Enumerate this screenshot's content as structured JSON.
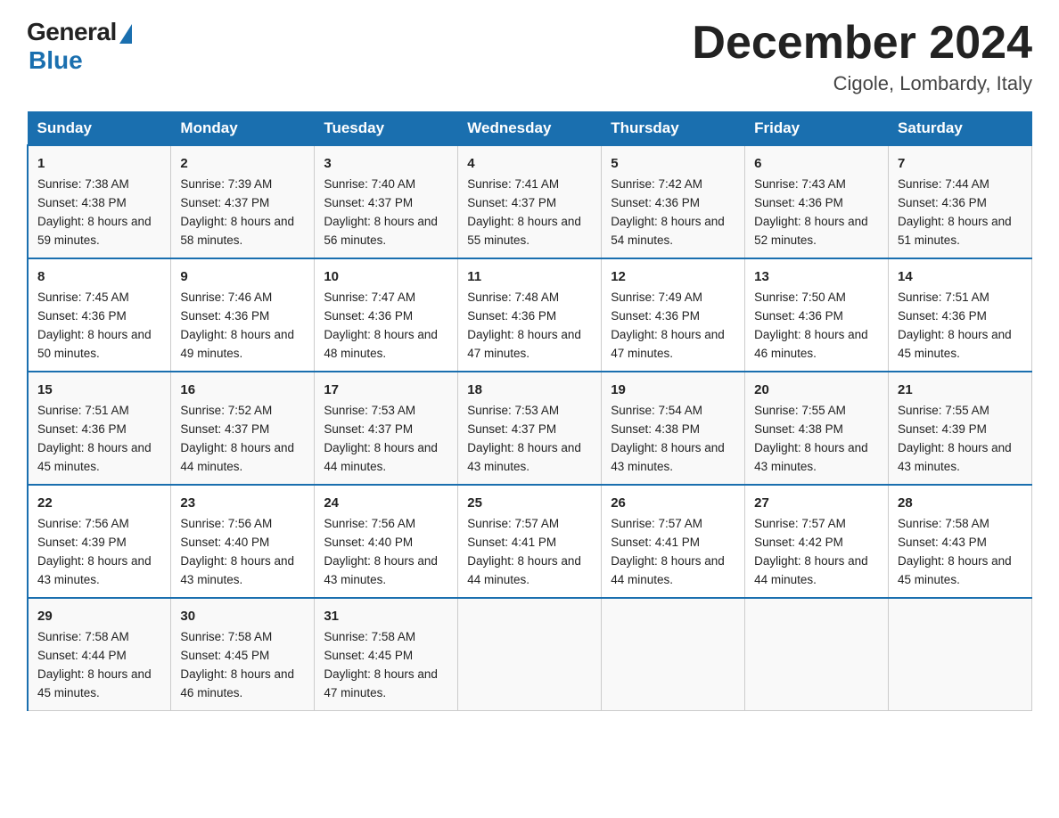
{
  "header": {
    "logo_general": "General",
    "logo_blue": "Blue",
    "month_title": "December 2024",
    "location": "Cigole, Lombardy, Italy"
  },
  "days_of_week": [
    "Sunday",
    "Monday",
    "Tuesday",
    "Wednesday",
    "Thursday",
    "Friday",
    "Saturday"
  ],
  "weeks": [
    [
      {
        "day": "1",
        "sunrise": "7:38 AM",
        "sunset": "4:38 PM",
        "daylight": "8 hours and 59 minutes."
      },
      {
        "day": "2",
        "sunrise": "7:39 AM",
        "sunset": "4:37 PM",
        "daylight": "8 hours and 58 minutes."
      },
      {
        "day": "3",
        "sunrise": "7:40 AM",
        "sunset": "4:37 PM",
        "daylight": "8 hours and 56 minutes."
      },
      {
        "day": "4",
        "sunrise": "7:41 AM",
        "sunset": "4:37 PM",
        "daylight": "8 hours and 55 minutes."
      },
      {
        "day": "5",
        "sunrise": "7:42 AM",
        "sunset": "4:36 PM",
        "daylight": "8 hours and 54 minutes."
      },
      {
        "day": "6",
        "sunrise": "7:43 AM",
        "sunset": "4:36 PM",
        "daylight": "8 hours and 52 minutes."
      },
      {
        "day": "7",
        "sunrise": "7:44 AM",
        "sunset": "4:36 PM",
        "daylight": "8 hours and 51 minutes."
      }
    ],
    [
      {
        "day": "8",
        "sunrise": "7:45 AM",
        "sunset": "4:36 PM",
        "daylight": "8 hours and 50 minutes."
      },
      {
        "day": "9",
        "sunrise": "7:46 AM",
        "sunset": "4:36 PM",
        "daylight": "8 hours and 49 minutes."
      },
      {
        "day": "10",
        "sunrise": "7:47 AM",
        "sunset": "4:36 PM",
        "daylight": "8 hours and 48 minutes."
      },
      {
        "day": "11",
        "sunrise": "7:48 AM",
        "sunset": "4:36 PM",
        "daylight": "8 hours and 47 minutes."
      },
      {
        "day": "12",
        "sunrise": "7:49 AM",
        "sunset": "4:36 PM",
        "daylight": "8 hours and 47 minutes."
      },
      {
        "day": "13",
        "sunrise": "7:50 AM",
        "sunset": "4:36 PM",
        "daylight": "8 hours and 46 minutes."
      },
      {
        "day": "14",
        "sunrise": "7:51 AM",
        "sunset": "4:36 PM",
        "daylight": "8 hours and 45 minutes."
      }
    ],
    [
      {
        "day": "15",
        "sunrise": "7:51 AM",
        "sunset": "4:36 PM",
        "daylight": "8 hours and 45 minutes."
      },
      {
        "day": "16",
        "sunrise": "7:52 AM",
        "sunset": "4:37 PM",
        "daylight": "8 hours and 44 minutes."
      },
      {
        "day": "17",
        "sunrise": "7:53 AM",
        "sunset": "4:37 PM",
        "daylight": "8 hours and 44 minutes."
      },
      {
        "day": "18",
        "sunrise": "7:53 AM",
        "sunset": "4:37 PM",
        "daylight": "8 hours and 43 minutes."
      },
      {
        "day": "19",
        "sunrise": "7:54 AM",
        "sunset": "4:38 PM",
        "daylight": "8 hours and 43 minutes."
      },
      {
        "day": "20",
        "sunrise": "7:55 AM",
        "sunset": "4:38 PM",
        "daylight": "8 hours and 43 minutes."
      },
      {
        "day": "21",
        "sunrise": "7:55 AM",
        "sunset": "4:39 PM",
        "daylight": "8 hours and 43 minutes."
      }
    ],
    [
      {
        "day": "22",
        "sunrise": "7:56 AM",
        "sunset": "4:39 PM",
        "daylight": "8 hours and 43 minutes."
      },
      {
        "day": "23",
        "sunrise": "7:56 AM",
        "sunset": "4:40 PM",
        "daylight": "8 hours and 43 minutes."
      },
      {
        "day": "24",
        "sunrise": "7:56 AM",
        "sunset": "4:40 PM",
        "daylight": "8 hours and 43 minutes."
      },
      {
        "day": "25",
        "sunrise": "7:57 AM",
        "sunset": "4:41 PM",
        "daylight": "8 hours and 44 minutes."
      },
      {
        "day": "26",
        "sunrise": "7:57 AM",
        "sunset": "4:41 PM",
        "daylight": "8 hours and 44 minutes."
      },
      {
        "day": "27",
        "sunrise": "7:57 AM",
        "sunset": "4:42 PM",
        "daylight": "8 hours and 44 minutes."
      },
      {
        "day": "28",
        "sunrise": "7:58 AM",
        "sunset": "4:43 PM",
        "daylight": "8 hours and 45 minutes."
      }
    ],
    [
      {
        "day": "29",
        "sunrise": "7:58 AM",
        "sunset": "4:44 PM",
        "daylight": "8 hours and 45 minutes."
      },
      {
        "day": "30",
        "sunrise": "7:58 AM",
        "sunset": "4:45 PM",
        "daylight": "8 hours and 46 minutes."
      },
      {
        "day": "31",
        "sunrise": "7:58 AM",
        "sunset": "4:45 PM",
        "daylight": "8 hours and 47 minutes."
      },
      {
        "day": "",
        "sunrise": "",
        "sunset": "",
        "daylight": ""
      },
      {
        "day": "",
        "sunrise": "",
        "sunset": "",
        "daylight": ""
      },
      {
        "day": "",
        "sunrise": "",
        "sunset": "",
        "daylight": ""
      },
      {
        "day": "",
        "sunrise": "",
        "sunset": "",
        "daylight": ""
      }
    ]
  ],
  "labels": {
    "sunrise": "Sunrise:",
    "sunset": "Sunset:",
    "daylight": "Daylight:"
  }
}
